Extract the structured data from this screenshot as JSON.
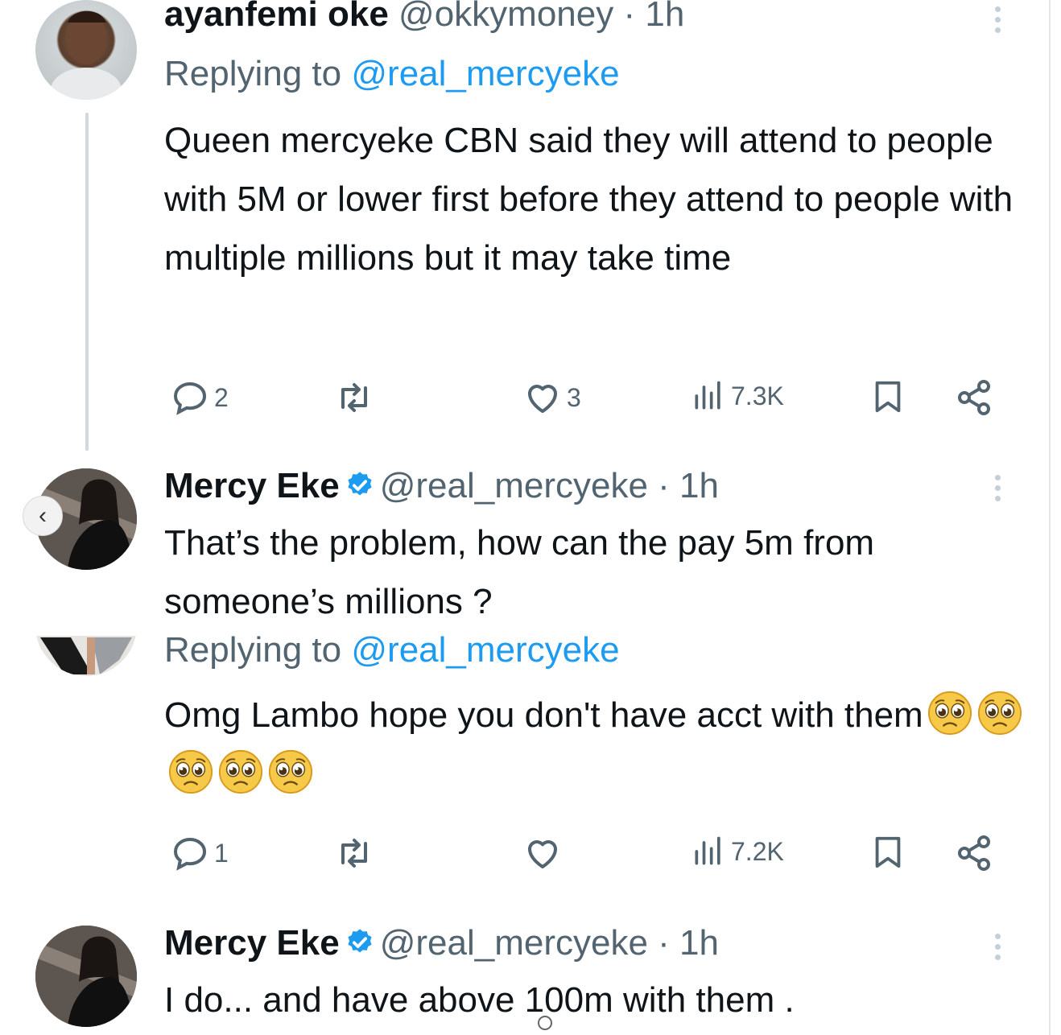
{
  "tweet1": {
    "name": "ayanfemi oke",
    "handle_time": "@okkymoney · 1h",
    "replying_prefix": "Replying to",
    "replying_handle": "@real_mercyeke",
    "text": "Queen mercyeke CBN said they will attend to people with 5M or lower first before they attend to people with multiple millions but it may take time",
    "replies": "2",
    "likes": "3",
    "views": "7.3K"
  },
  "tweet2": {
    "name": "Mercy Eke",
    "handle_time": "@real_mercyeke · 1h",
    "text": "That’s the problem, how can the pay 5m from someone’s millions ?"
  },
  "tweet3": {
    "replying_prefix": "Replying to",
    "replying_handle": "@real_mercyeke",
    "text": "Omg Lambo hope you don't have acct with them",
    "replies": "1",
    "views": "7.2K"
  },
  "tweet4": {
    "name": "Mercy Eke",
    "handle_time": "@real_mercyeke · 1h",
    "text": "I do... and have above 100m with them ."
  },
  "icons": {
    "reply": "reply-icon",
    "retweet": "retweet-icon",
    "like": "heart-icon",
    "views": "analytics-icon",
    "bookmark": "bookmark-icon",
    "share": "share-icon",
    "verified": "verified-badge-icon",
    "more": "more-icon",
    "back": "chevron-left-icon",
    "emoji": "pleading-face-emoji"
  },
  "colors": {
    "text": "#0f1419",
    "muted": "#536471",
    "link": "#1d9bf0",
    "verified": "#1d9bf0",
    "thread_line": "#cfd9de"
  }
}
